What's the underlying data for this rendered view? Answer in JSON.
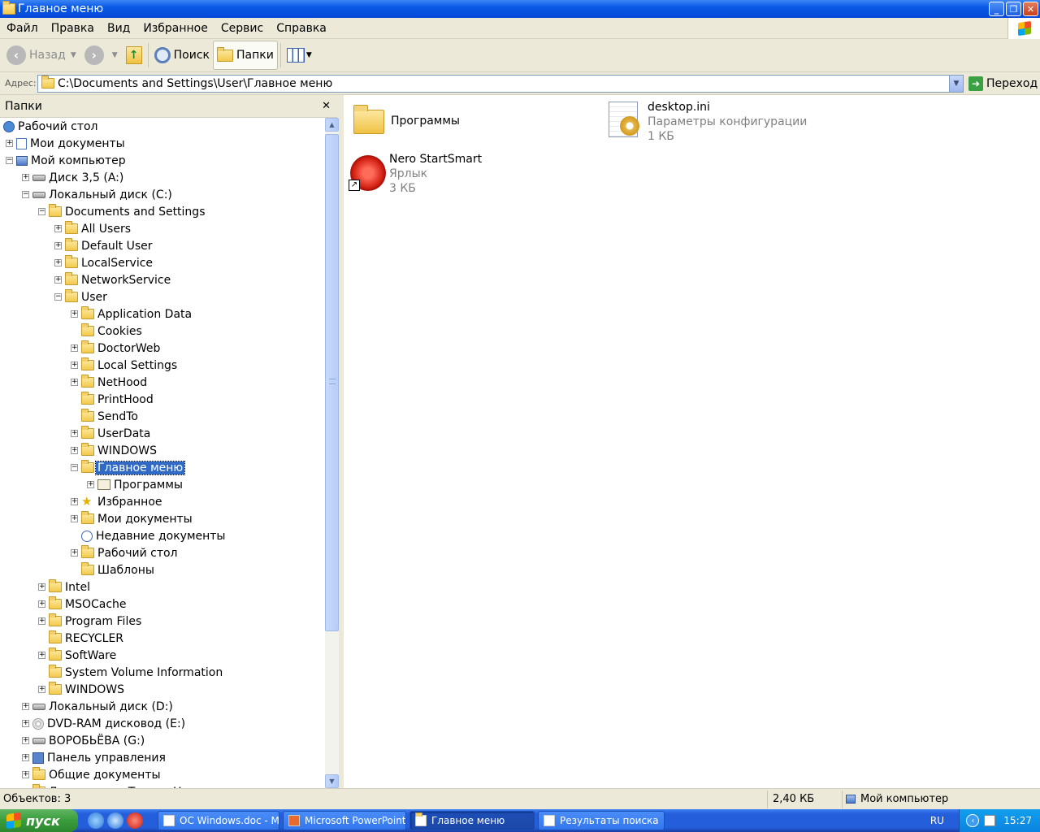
{
  "window": {
    "title": "Главное меню"
  },
  "menu": [
    "Файл",
    "Правка",
    "Вид",
    "Избранное",
    "Сервис",
    "Справка"
  ],
  "toolbar": {
    "back": "Назад",
    "search": "Поиск",
    "folders": "Папки"
  },
  "address": {
    "label": "Адрес:",
    "value": "C:\\Documents and Settings\\User\\Главное меню",
    "go": "Переход"
  },
  "folders_pane": {
    "title": "Папки"
  },
  "tree": [
    {
      "label": "Рабочий стол",
      "depth": 0,
      "exp": "none",
      "icon": "desktop"
    },
    {
      "label": "Мои документы",
      "depth": 1,
      "exp": "plus",
      "icon": "docs"
    },
    {
      "label": "Мой компьютер",
      "depth": 1,
      "exp": "minus",
      "icon": "computer"
    },
    {
      "label": "Диск 3,5 (A:)",
      "depth": 2,
      "exp": "plus",
      "icon": "floppy"
    },
    {
      "label": "Локальный диск (C:)",
      "depth": 2,
      "exp": "minus",
      "icon": "drive"
    },
    {
      "label": "Documents and Settings",
      "depth": 3,
      "exp": "minus",
      "icon": "folder"
    },
    {
      "label": "All Users",
      "depth": 4,
      "exp": "plus",
      "icon": "folder"
    },
    {
      "label": "Default User",
      "depth": 4,
      "exp": "plus",
      "icon": "folder"
    },
    {
      "label": "LocalService",
      "depth": 4,
      "exp": "plus",
      "icon": "folder"
    },
    {
      "label": "NetworkService",
      "depth": 4,
      "exp": "plus",
      "icon": "folder"
    },
    {
      "label": "User",
      "depth": 4,
      "exp": "minus",
      "icon": "folder"
    },
    {
      "label": "Application Data",
      "depth": 5,
      "exp": "plus",
      "icon": "folder"
    },
    {
      "label": "Cookies",
      "depth": 5,
      "exp": "none",
      "icon": "folder"
    },
    {
      "label": "DoctorWeb",
      "depth": 5,
      "exp": "plus",
      "icon": "folder"
    },
    {
      "label": "Local Settings",
      "depth": 5,
      "exp": "plus",
      "icon": "folder"
    },
    {
      "label": "NetHood",
      "depth": 5,
      "exp": "plus",
      "icon": "folder"
    },
    {
      "label": "PrintHood",
      "depth": 5,
      "exp": "none",
      "icon": "folder"
    },
    {
      "label": "SendTo",
      "depth": 5,
      "exp": "none",
      "icon": "folder"
    },
    {
      "label": "UserData",
      "depth": 5,
      "exp": "plus",
      "icon": "folder"
    },
    {
      "label": "WINDOWS",
      "depth": 5,
      "exp": "plus",
      "icon": "folder"
    },
    {
      "label": "Главное меню",
      "depth": 5,
      "exp": "minus",
      "icon": "folder-open",
      "selected": true
    },
    {
      "label": "Программы",
      "depth": 6,
      "exp": "plus",
      "icon": "programs"
    },
    {
      "label": "Избранное",
      "depth": 5,
      "exp": "plus",
      "icon": "star"
    },
    {
      "label": "Мои документы",
      "depth": 5,
      "exp": "plus",
      "icon": "folder"
    },
    {
      "label": "Недавние документы",
      "depth": 5,
      "exp": "none",
      "icon": "recent"
    },
    {
      "label": "Рабочий стол",
      "depth": 5,
      "exp": "plus",
      "icon": "folder"
    },
    {
      "label": "Шаблоны",
      "depth": 5,
      "exp": "none",
      "icon": "folder"
    },
    {
      "label": "Intel",
      "depth": 3,
      "exp": "plus",
      "icon": "folder"
    },
    {
      "label": "MSOCache",
      "depth": 3,
      "exp": "plus",
      "icon": "folder"
    },
    {
      "label": "Program Files",
      "depth": 3,
      "exp": "plus",
      "icon": "folder"
    },
    {
      "label": "RECYCLER",
      "depth": 3,
      "exp": "none",
      "icon": "folder"
    },
    {
      "label": "SoftWare",
      "depth": 3,
      "exp": "plus",
      "icon": "folder"
    },
    {
      "label": "System Volume Information",
      "depth": 3,
      "exp": "none",
      "icon": "folder"
    },
    {
      "label": "WINDOWS",
      "depth": 3,
      "exp": "plus",
      "icon": "folder"
    },
    {
      "label": "Локальный диск (D:)",
      "depth": 2,
      "exp": "plus",
      "icon": "drive"
    },
    {
      "label": "DVD-RAM дисковод (E:)",
      "depth": 2,
      "exp": "plus",
      "icon": "dvd"
    },
    {
      "label": "ВОРОБЬЁВА (G:)",
      "depth": 2,
      "exp": "plus",
      "icon": "drive"
    },
    {
      "label": "Панель управления",
      "depth": 2,
      "exp": "plus",
      "icon": "control"
    },
    {
      "label": "Общие документы",
      "depth": 2,
      "exp": "plus",
      "icon": "folder"
    },
    {
      "label": "Документы - Tuuuuu H",
      "depth": 2,
      "exp": "plus",
      "icon": "folder"
    }
  ],
  "files": [
    {
      "name": "Программы",
      "type": "",
      "size": "",
      "icon": "folder"
    },
    {
      "name": "desktop.ini",
      "type": "Параметры конфигурации",
      "size": "1 КБ",
      "icon": "ini"
    },
    {
      "name": "Nero StartSmart",
      "type": "Ярлык",
      "size": "3 КБ",
      "icon": "nero-shortcut"
    }
  ],
  "status": {
    "objects": "Объектов: 3",
    "size": "2,40 КБ",
    "location": "Мой компьютер"
  },
  "taskbar": {
    "start": "пуск",
    "tasks": [
      "ОС Windows.doc - Mi...",
      "Microsoft PowerPoint ...",
      "Главное меню",
      "Результаты поиска"
    ],
    "lang": "RU",
    "clock": "15:27"
  },
  "colors": {
    "selection": "#316ac5",
    "titlebar": "#0a5ae6",
    "taskbar": "#245edb",
    "start": "#399c3b"
  }
}
